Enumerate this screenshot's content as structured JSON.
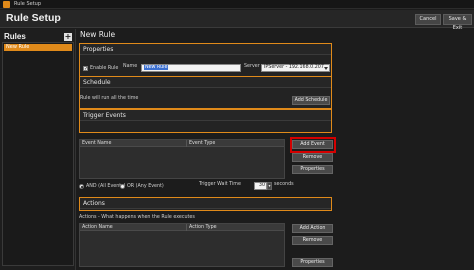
{
  "window": {
    "title": "Rule Setup",
    "icon": "app-logo-icon"
  },
  "header": {
    "title": "Rule Setup",
    "cancel_label": "Cancel",
    "save_label": "Save & Exit"
  },
  "sidebar": {
    "heading": "Rules",
    "add_icon": "plus-icon",
    "items": [
      {
        "label": "New Rule",
        "selected": true
      }
    ]
  },
  "main": {
    "rule_title": "New Rule",
    "properties": {
      "heading": "Properties",
      "enable_checked": true,
      "enable_label": "Enable Rule",
      "name_label": "Name",
      "name_value": "New Rule",
      "server_label": "Server",
      "server_value": "IPServer - 192.168.0.207"
    },
    "schedule": {
      "heading": "Schedule",
      "text": "Rule will run all the time",
      "add_button": "Add Schedule"
    },
    "trigger": {
      "heading": "Trigger Events",
      "columns": [
        "Event Name",
        "Event Type"
      ],
      "rows": [],
      "add_button": "Add Event",
      "remove_button": "Remove",
      "properties_button": "Properties",
      "and_label": "AND (All Events)",
      "or_label": "OR (Any Event)",
      "selected_logic": "AND",
      "wait_label": "Trigger Wait Time",
      "wait_value": "30",
      "wait_unit": "seconds"
    },
    "actions": {
      "heading": "Actions",
      "subtext": "Actions - What happens when the Rule executes",
      "columns": [
        "Action Name",
        "Action Type"
      ],
      "rows": [],
      "add_button": "Add Action",
      "remove_button": "Remove",
      "properties_button": "Properties"
    }
  },
  "colors": {
    "accent": "#e08a1a",
    "highlight": "#d40000",
    "background": "#1c1c1c"
  }
}
